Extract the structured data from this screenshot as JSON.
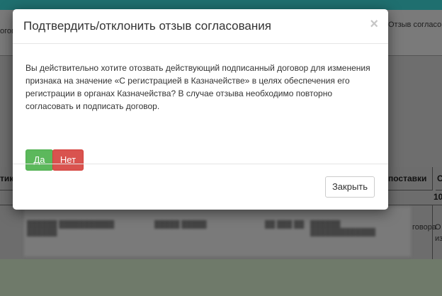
{
  "background": {
    "header_left_text": "огов",
    "header_right_text": "Отзыв согласо",
    "table_headers": [
      "тик",
      "поставки",
      "С"
    ],
    "subrow_number": "10",
    "row_right_text": [
      "говора",
      "О",
      "из"
    ]
  },
  "modal": {
    "title": "Подтвердить/отклонить отзыв согласования",
    "close_glyph": "×",
    "message": "Вы действительно хотите отозвать действующий подписанный договор для изменения признака на значение «С регистрацией в Казначействе» в целях обеспечения его регистрации в органах Казначейства? В случае отзыва необходимо повторно согласовать и подписать договор.",
    "yes_label": "Да",
    "no_label": "Нет",
    "close_button_label": "Закрыть"
  },
  "colors": {
    "yes_button": "#5cb85c",
    "no_button": "#d9534f",
    "top_bar": "#1f6f6f"
  }
}
